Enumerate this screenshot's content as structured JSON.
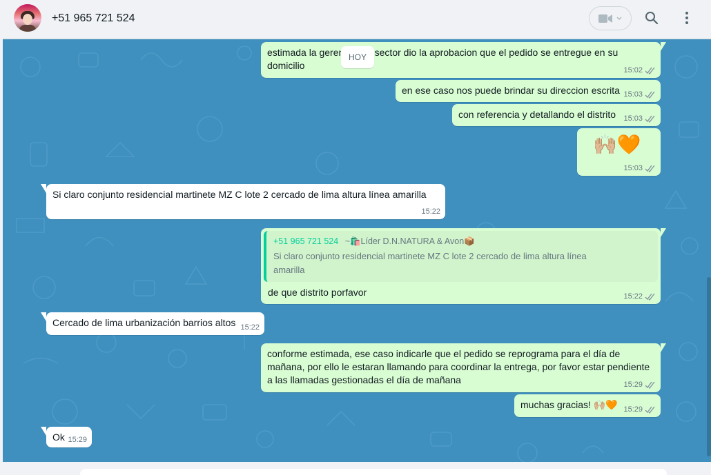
{
  "header": {
    "contact_name": "+51 965 721 524",
    "icons": {
      "video": "video-camera-icon",
      "dropdown": "chevron-down-icon",
      "search": "search-icon",
      "menu": "kebab-menu-icon"
    }
  },
  "colors": {
    "chat_background": "#3f90bf",
    "outgoing_bubble": "#d9fdd3",
    "incoming_bubble": "#ffffff",
    "read_ticks": "#8696a0",
    "quote_accent": "#06cf9c"
  },
  "chat": {
    "day_label": "HOY",
    "messages": [
      {
        "dir": "out",
        "text": "estimada la gerencia del sector dio la aprobacion que el pedido se entregue en su domicilio",
        "time": "15:02",
        "status": "read"
      },
      {
        "dir": "out",
        "text": "en ese caso nos puede brindar su direccion escrita",
        "time": "15:03",
        "status": "read"
      },
      {
        "dir": "out",
        "text": "con referencia y detallando el distrito",
        "time": "15:03",
        "status": "read"
      },
      {
        "dir": "out",
        "text": "🙌🏼🧡",
        "time": "15:03",
        "status": "read"
      },
      {
        "dir": "in",
        "text": "Si claro conjunto residencial martinete MZ C lote 2 cercado de lima altura línea amarilla",
        "time": "15:22"
      },
      {
        "dir": "out",
        "text": "de que distrito porfavor",
        "time": "15:22",
        "status": "read",
        "quote": {
          "author": "+51 965 721 524",
          "alias": "~🛍️Líder D.N.NATURA & Avon📦",
          "text": "Si claro conjunto residencial martinete MZ C lote 2 cercado de lima altura línea amarilla"
        }
      },
      {
        "dir": "in",
        "text": "Cercado de lima urbanización barrios altos",
        "time": "15:22"
      },
      {
        "dir": "out",
        "text": "conforme estimada, ese caso indicarle que el pedido se reprograma para el día de mañana, por ello le estaran llamando para coordinar la entrega, por favor estar pendiente a las llamadas gestionadas el día de mañana",
        "time": "15:29",
        "status": "read"
      },
      {
        "dir": "out",
        "text": "muchas gracias! 🙌🏼🧡",
        "time": "15:29",
        "status": "read"
      },
      {
        "dir": "in",
        "text": "Ok",
        "time": "15:29"
      }
    ]
  }
}
